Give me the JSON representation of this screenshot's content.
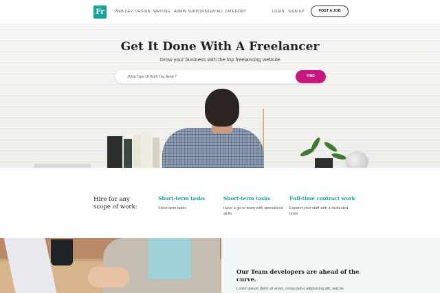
{
  "colors": {
    "brand": "#16a596",
    "accent": "#c5177f"
  },
  "nav": {
    "logo": "Fr",
    "links": [
      "WEB DEV",
      "DESIGN",
      "WRITING",
      "ADMIN SUPPORT",
      "VIEW ALL CATEGORY"
    ],
    "login": "LOGIN",
    "signup": "SIGN UP",
    "post_job": "POST A JOB"
  },
  "hero": {
    "title": "Get It Done With A Freelancer",
    "subtitle": "Grow your business with the top freelancing website",
    "search_placeholder": "What Type Of Work You Need ?",
    "find": "FIND"
  },
  "hire": {
    "title": "Hire for any scope of work:",
    "tasks": [
      {
        "title": "Short-term tasks",
        "desc": "Short-term tasks"
      },
      {
        "title": "Short-term tasks",
        "desc": "Have a go-to team with specialized skills"
      },
      {
        "title": "Full-time contract work",
        "desc": "Expand your staff with a dedicated team"
      }
    ]
  },
  "team": {
    "title": "Our Team developers are ahead of the curve.",
    "text": "Lorem ipsum dolor sit amet, consectetur adipisicing elit, sed do"
  }
}
